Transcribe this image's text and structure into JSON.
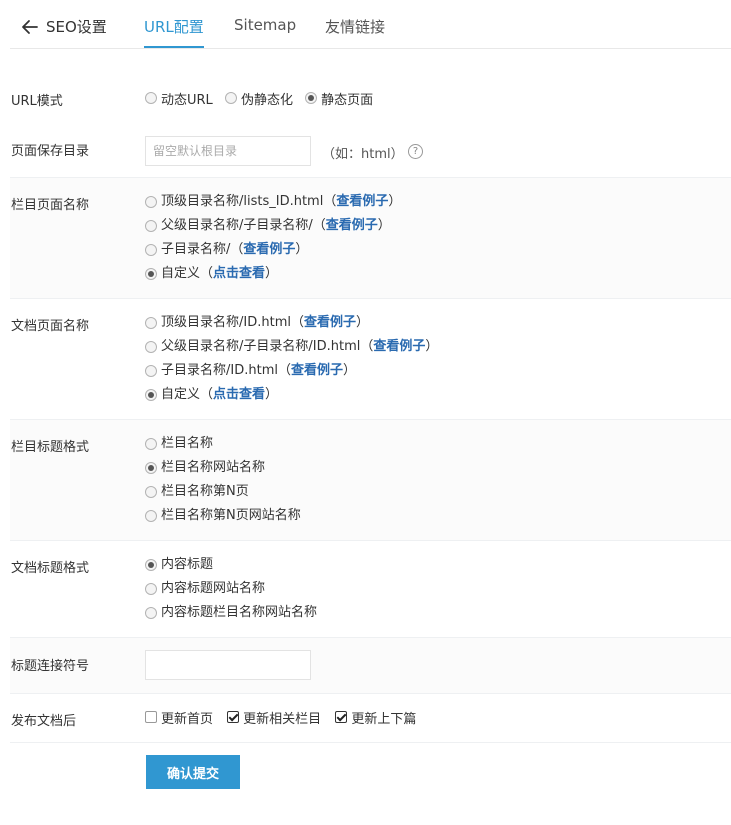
{
  "header": {
    "title": "SEO设置",
    "tabs": [
      {
        "label": "URL配置",
        "active": true
      },
      {
        "label": "Sitemap",
        "active": false
      },
      {
        "label": "友情链接",
        "active": false
      }
    ]
  },
  "url_mode": {
    "label": "URL模式",
    "options": [
      {
        "label": "动态URL",
        "selected": false
      },
      {
        "label": "伪静态化",
        "selected": false
      },
      {
        "label": "静态页面",
        "selected": true
      }
    ]
  },
  "save_dir": {
    "label": "页面保存目录",
    "placeholder": "留空默认根目录",
    "value": "",
    "hint": "（如：html）",
    "help": "?"
  },
  "column_page": {
    "label": "栏目页面名称",
    "options": [
      {
        "label": "顶级目录名称/lists_ID.html（",
        "link": "查看例子",
        "suffix": "）",
        "selected": false
      },
      {
        "label": "父级目录名称/子目录名称/（",
        "link": "查看例子",
        "suffix": "）",
        "selected": false
      },
      {
        "label": "子目录名称/（",
        "link": "查看例子",
        "suffix": "）",
        "selected": false
      },
      {
        "label": "自定义（",
        "link": "点击查看",
        "suffix": "）",
        "selected": true
      }
    ]
  },
  "doc_page": {
    "label": "文档页面名称",
    "options": [
      {
        "label": "顶级目录名称/ID.html（",
        "link": "查看例子",
        "suffix": "）",
        "selected": false
      },
      {
        "label": "父级目录名称/子目录名称/ID.html（",
        "link": "查看例子",
        "suffix": "）",
        "selected": false
      },
      {
        "label": "子目录名称/ID.html（",
        "link": "查看例子",
        "suffix": "）",
        "selected": false
      },
      {
        "label": "自定义（",
        "link": "点击查看",
        "suffix": "）",
        "selected": true
      }
    ]
  },
  "column_title": {
    "label": "栏目标题格式",
    "options": [
      {
        "label": "栏目名称",
        "selected": false
      },
      {
        "label": "栏目名称网站名称",
        "selected": true
      },
      {
        "label": "栏目名称第N页",
        "selected": false
      },
      {
        "label": "栏目名称第N页网站名称",
        "selected": false
      }
    ]
  },
  "doc_title": {
    "label": "文档标题格式",
    "options": [
      {
        "label": "内容标题",
        "selected": true
      },
      {
        "label": "内容标题网站名称",
        "selected": false
      },
      {
        "label": "内容标题栏目名称网站名称",
        "selected": false
      }
    ]
  },
  "separator": {
    "label": "标题连接符号",
    "value": ""
  },
  "after_publish": {
    "label": "发布文档后",
    "options": [
      {
        "label": "更新首页",
        "checked": false
      },
      {
        "label": "更新相关栏目",
        "checked": true
      },
      {
        "label": "更新上下篇",
        "checked": true
      }
    ]
  },
  "submit_label": "确认提交"
}
